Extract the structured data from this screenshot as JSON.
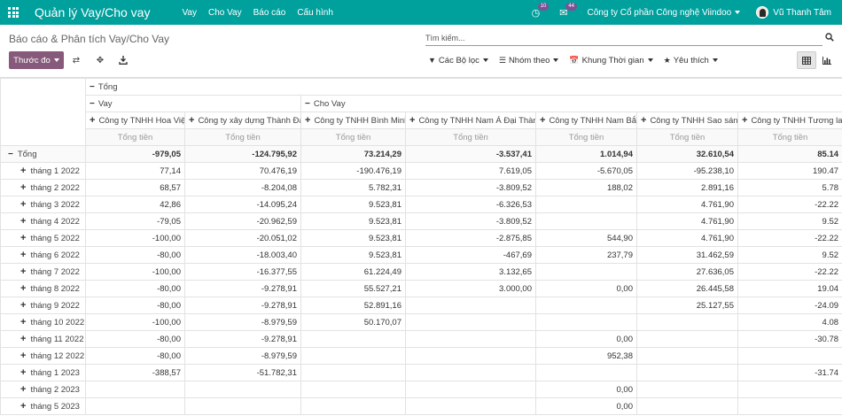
{
  "app": {
    "title": "Quản lý Vay/Cho vay",
    "menu": [
      "Vay",
      "Cho Vay",
      "Báo cáo",
      "Cấu hình"
    ],
    "activity_badge": "10",
    "message_badge": "44",
    "company": "Công ty Cổ phần Công nghệ Viindoo",
    "user": "Vũ Thanh Tâm"
  },
  "control": {
    "breadcrumb": "Báo cáo & Phân tích Vay/Cho Vay",
    "search_placeholder": "Tìm kiếm...",
    "measure_label": "Thước đo",
    "filters_label": "Các Bộ lọc",
    "group_label": "Nhóm theo",
    "timeframe_label": "Khung Thời gian",
    "favorites_label": "Yêu thích"
  },
  "pivot": {
    "total_label": "Tổng",
    "group_vay": "Vay",
    "group_chovay": "Cho Vay",
    "measure": "Tổng tiền",
    "companies": [
      "Công ty TNHH Hoa Việt",
      "Công ty xây dựng Thành Đạt",
      "Công ty TNHH Bình Minh",
      "Công ty TNHH Nam Á Đại Thành",
      "Công ty TNHH Nam Bắc",
      "Công ty TNHH Sao sáng",
      "Công ty TNHH Tương lai s"
    ],
    "total_row": [
      "-979,05",
      "-124.795,92",
      "73.214,29",
      "-3.537,41",
      "1.014,94",
      "32.610,54",
      "85.14"
    ],
    "rows": [
      {
        "label": "tháng 1 2022",
        "values": [
          "77,14",
          "70.476,19",
          "-190.476,19",
          "7.619,05",
          "-5.670,05",
          "-95.238,10",
          "190.47"
        ]
      },
      {
        "label": "tháng 2 2022",
        "values": [
          "68,57",
          "-8.204,08",
          "5.782,31",
          "-3.809,52",
          "188,02",
          "2.891,16",
          "5.78"
        ]
      },
      {
        "label": "tháng 3 2022",
        "values": [
          "42,86",
          "-14.095,24",
          "9.523,81",
          "-6.326,53",
          "",
          "4.761,90",
          "-22.22"
        ]
      },
      {
        "label": "tháng 4 2022",
        "values": [
          "-79,05",
          "-20.962,59",
          "9.523,81",
          "-3.809,52",
          "",
          "4.761,90",
          "9.52"
        ]
      },
      {
        "label": "tháng 5 2022",
        "values": [
          "-100,00",
          "-20.051,02",
          "9.523,81",
          "-2.875,85",
          "544,90",
          "4.761,90",
          "-22.22"
        ]
      },
      {
        "label": "tháng 6 2022",
        "values": [
          "-80,00",
          "-18.003,40",
          "9.523,81",
          "-467,69",
          "237,79",
          "31.462,59",
          "9.52"
        ]
      },
      {
        "label": "tháng 7 2022",
        "values": [
          "-100,00",
          "-16.377,55",
          "61.224,49",
          "3.132,65",
          "",
          "27.636,05",
          "-22.22"
        ]
      },
      {
        "label": "tháng 8 2022",
        "values": [
          "-80,00",
          "-9.278,91",
          "55.527,21",
          "3.000,00",
          "0,00",
          "26.445,58",
          "19.04"
        ]
      },
      {
        "label": "tháng 9 2022",
        "values": [
          "-80,00",
          "-9.278,91",
          "52.891,16",
          "",
          "",
          "25.127,55",
          "-24.09"
        ]
      },
      {
        "label": "tháng 10 2022",
        "values": [
          "-100,00",
          "-8.979,59",
          "50.170,07",
          "",
          "",
          "",
          "4.08"
        ]
      },
      {
        "label": "tháng 11 2022",
        "values": [
          "-80,00",
          "-9.278,91",
          "",
          "",
          "0,00",
          "",
          "-30.78"
        ]
      },
      {
        "label": "tháng 12 2022",
        "values": [
          "-80,00",
          "-8.979,59",
          "",
          "",
          "952,38",
          "",
          ""
        ]
      },
      {
        "label": "tháng 1 2023",
        "values": [
          "-388,57",
          "-51.782,31",
          "",
          "",
          "",
          "",
          "-31.74"
        ]
      },
      {
        "label": "tháng 2 2023",
        "values": [
          "",
          "",
          "",
          "",
          "0,00",
          "",
          ""
        ]
      },
      {
        "label": "tháng 5 2023",
        "values": [
          "",
          "",
          "",
          "",
          "0,00",
          "",
          ""
        ]
      }
    ]
  }
}
